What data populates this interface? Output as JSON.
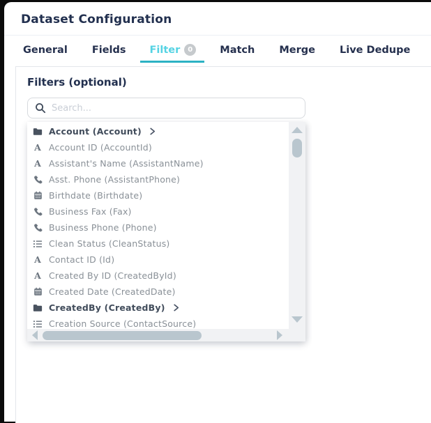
{
  "window": {
    "title": "Dataset Configuration"
  },
  "tabs": {
    "items": [
      {
        "label": "General",
        "active": false
      },
      {
        "label": "Fields",
        "active": false
      },
      {
        "label": "Filter",
        "active": true,
        "badge": "0"
      },
      {
        "label": "Match",
        "active": false
      },
      {
        "label": "Merge",
        "active": false
      },
      {
        "label": "Live Dedupe",
        "active": false
      }
    ]
  },
  "filter_panel": {
    "heading": "Filters (optional)",
    "search": {
      "placeholder": "Search..."
    },
    "field_list": {
      "items": [
        {
          "label": "Account (Account)",
          "icon": "folder",
          "bold": true,
          "expandable": true
        },
        {
          "label": "Account ID (AccountId)",
          "icon": "text",
          "bold": false,
          "expandable": false
        },
        {
          "label": "Assistant's Name (AssistantName)",
          "icon": "text",
          "bold": false,
          "expandable": false
        },
        {
          "label": "Asst. Phone (AssistantPhone)",
          "icon": "phone",
          "bold": false,
          "expandable": false
        },
        {
          "label": "Birthdate (Birthdate)",
          "icon": "calendar",
          "bold": false,
          "expandable": false
        },
        {
          "label": "Business Fax (Fax)",
          "icon": "phone",
          "bold": false,
          "expandable": false
        },
        {
          "label": "Business Phone (Phone)",
          "icon": "phone",
          "bold": false,
          "expandable": false
        },
        {
          "label": "Clean Status (CleanStatus)",
          "icon": "list",
          "bold": false,
          "expandable": false
        },
        {
          "label": "Contact ID (Id)",
          "icon": "text",
          "bold": false,
          "expandable": false
        },
        {
          "label": "Created By ID (CreatedById)",
          "icon": "text",
          "bold": false,
          "expandable": false
        },
        {
          "label": "Created Date (CreatedDate)",
          "icon": "calendar",
          "bold": false,
          "expandable": false
        },
        {
          "label": "CreatedBy (CreatedBy)",
          "icon": "folder",
          "bold": true,
          "expandable": true
        },
        {
          "label": "Creation Source (ContactSource)",
          "icon": "list",
          "bold": false,
          "expandable": false
        }
      ]
    },
    "text_icon_glyph": "A"
  },
  "colors": {
    "accent_active_tab": "#55d3e3",
    "accent_underline": "#2cb2c4",
    "heading_navy": "#22304f",
    "scrollbar": "#b9c6ce"
  }
}
